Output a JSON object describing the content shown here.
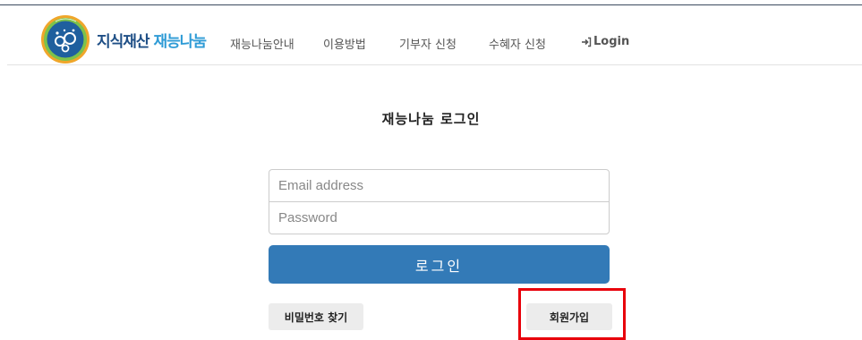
{
  "brand": {
    "logo_name_part1": "지식재산",
    "logo_name_part2": "재능나눔",
    "logo_arc_text": "지식재산 재능나눔",
    "color_primary": "#1f4f86",
    "color_accent": "#2e9bd6",
    "color_ring_orange": "#f0a62a",
    "color_ring_green": "#7cc24b"
  },
  "nav": {
    "items": [
      {
        "label": "재능나눔안내"
      },
      {
        "label": "이용방법"
      },
      {
        "label": "기부자 신청"
      },
      {
        "label": "수혜자 신청"
      }
    ],
    "login_label": "Login",
    "login_icon": "sign-in-icon"
  },
  "login": {
    "title": "재능나눔 로그인",
    "email_placeholder": "Email address",
    "password_placeholder": "Password",
    "submit_label": "로그인",
    "submit_color": "#337ab7",
    "find_password_label": "비밀번호 찾기",
    "signup_label": "회원가입",
    "highlight_color": "#e8000b"
  }
}
